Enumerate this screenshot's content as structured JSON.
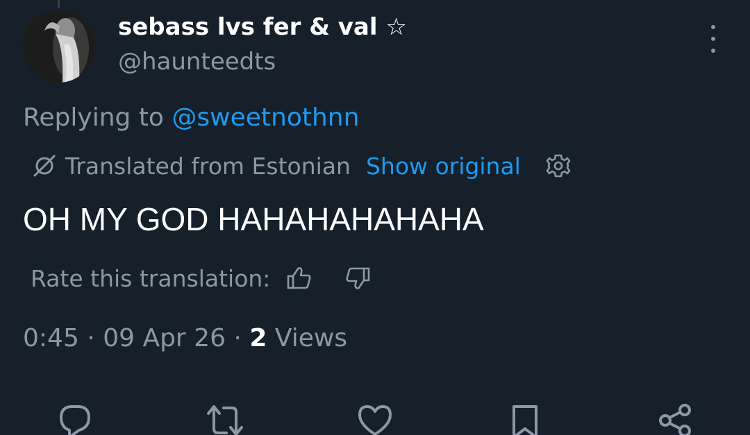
{
  "author": {
    "display_name": "sebass lvs fer & val ☆",
    "handle": "@haunteedts"
  },
  "reply": {
    "prefix": "Replying to",
    "mention": "@sweetnothnn"
  },
  "translation": {
    "label": "Translated from Estonian",
    "show_original": "Show original",
    "rate_label": "Rate this translation:"
  },
  "tweet": {
    "text": "OH MY GOD HAHAHAHAHAHA"
  },
  "meta": {
    "time": "0:45",
    "separator": "·",
    "date": "09 Apr 26",
    "views_count": "2",
    "views_label": "Views"
  },
  "icons": {
    "more": "more-vertical-icon",
    "translate": "globe-slash-icon",
    "settings": "gear-icon",
    "rate_up": "thumbs-up-icon",
    "rate_down": "thumbs-down-icon",
    "reply": "reply-icon",
    "retweet": "retweet-icon",
    "like": "heart-icon",
    "bookmark": "bookmark-icon",
    "share": "share-icon"
  },
  "colors": {
    "background": "#15202b",
    "text_primary": "#ffffff",
    "text_secondary": "#8b98a5",
    "accent": "#1d9bf0"
  }
}
